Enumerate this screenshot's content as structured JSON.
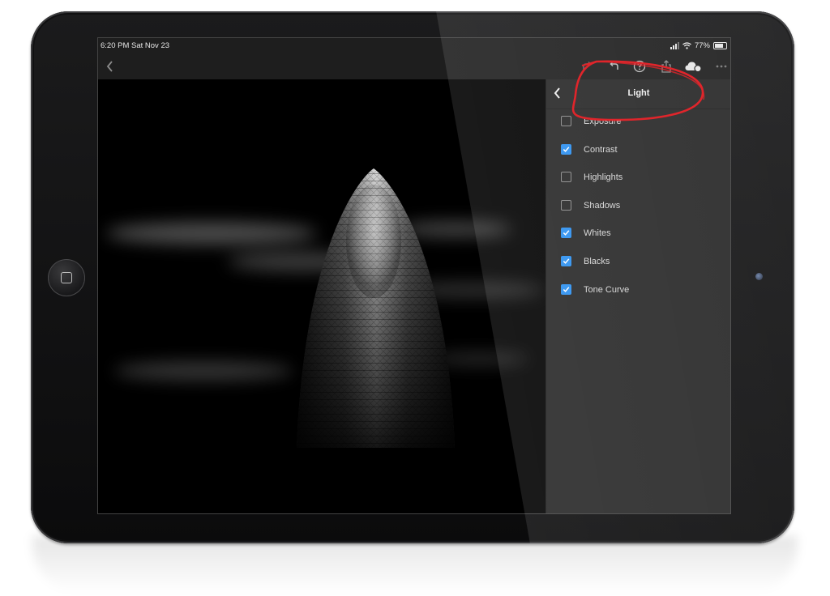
{
  "status_bar": {
    "time": "6:20 PM  Sat Nov 23",
    "battery_percent": "77%"
  },
  "toolbar": {
    "icons": [
      "back-chevron-icon",
      "redo-icon",
      "undo-icon",
      "help-icon",
      "share-icon",
      "cloud-sync-icon",
      "more-icon"
    ]
  },
  "panel": {
    "title": "Light",
    "items": [
      {
        "label": "Exposure",
        "checked": false
      },
      {
        "label": "Contrast",
        "checked": true
      },
      {
        "label": "Highlights",
        "checked": false
      },
      {
        "label": "Shadows",
        "checked": false
      },
      {
        "label": "Whites",
        "checked": true
      },
      {
        "label": "Blacks",
        "checked": true
      },
      {
        "label": "Tone Curve",
        "checked": true
      }
    ]
  },
  "colors": {
    "accent": "#2b8ff0",
    "annotation": "#e0252b",
    "panel_bg": "#272727",
    "toolbar_bg": "#1e1e1e"
  }
}
